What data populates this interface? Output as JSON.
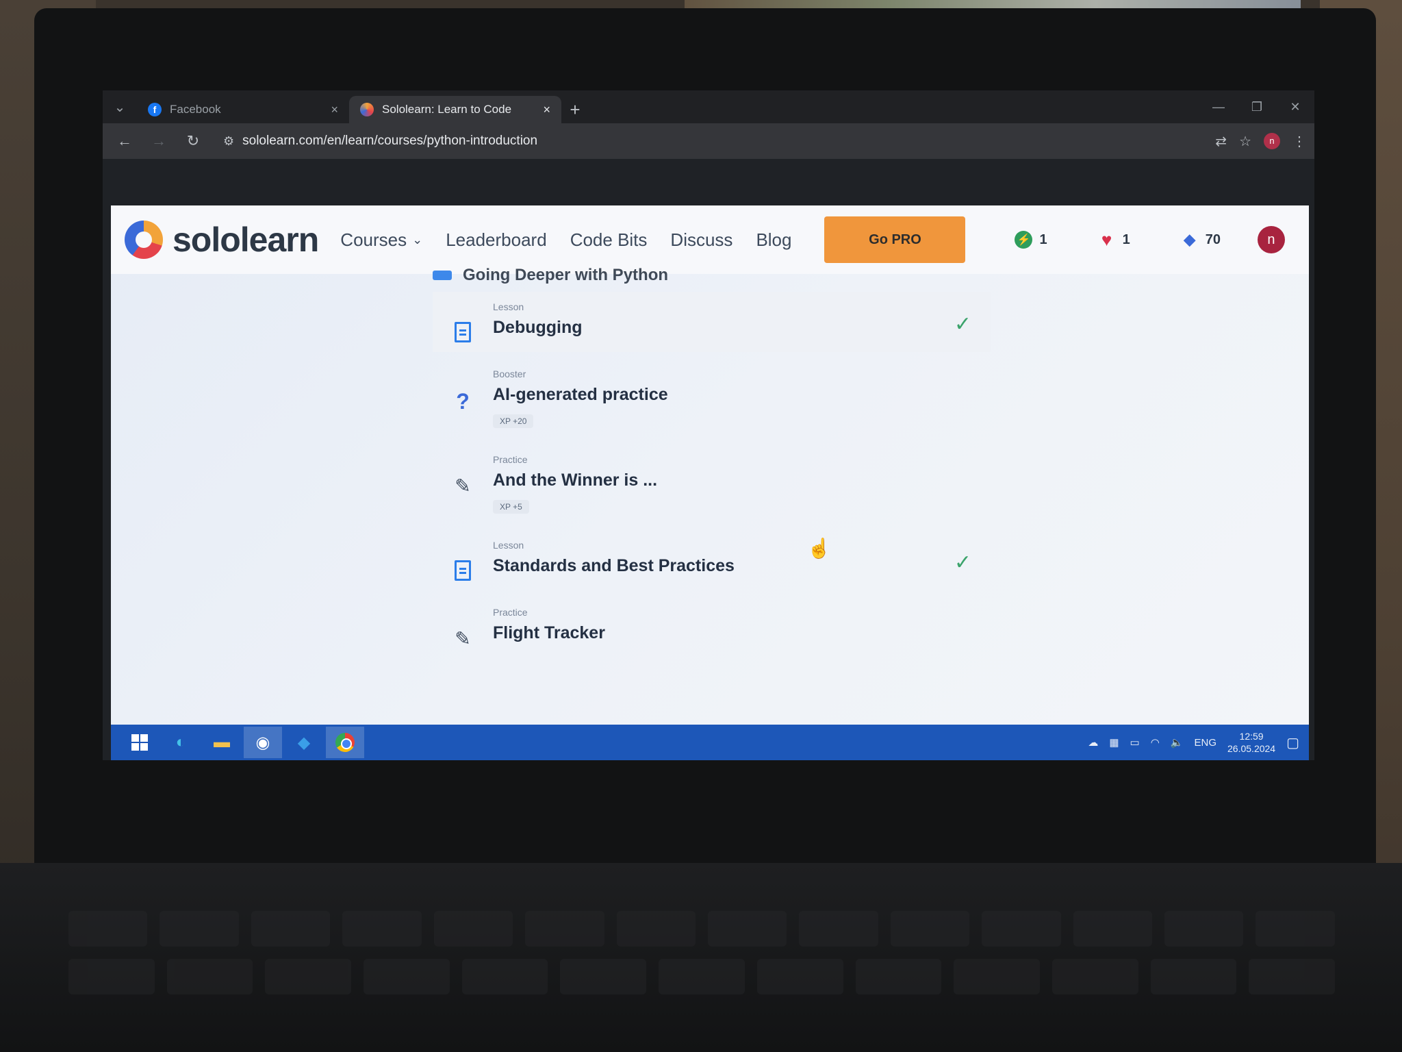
{
  "browser": {
    "tabs": [
      {
        "title": "Facebook",
        "active": false
      },
      {
        "title": "Sololearn: Learn to Code",
        "active": true
      }
    ],
    "url": "sololearn.com/en/learn/courses/python-introduction"
  },
  "navbar": {
    "logo": "sololearn",
    "menu": [
      "Courses",
      "Leaderboard",
      "Code Bits",
      "Discuss",
      "Blog"
    ],
    "go_pro": "Go PRO",
    "streak": "1",
    "hearts": "1",
    "gems": "70",
    "avatar_initial": "n"
  },
  "section_heading": "Going Deeper with Python",
  "lessons": [
    {
      "kind": "Lesson",
      "title": "Debugging",
      "xp": "",
      "completed": true,
      "icon": "document-icon"
    },
    {
      "kind": "Booster",
      "title": "AI-generated practice",
      "xp": "XP +20",
      "completed": false,
      "icon": "question-icon"
    },
    {
      "kind": "Practice",
      "title": "And the Winner is ...",
      "xp": "XP +5",
      "completed": false,
      "icon": "pencil-icon"
    },
    {
      "kind": "Lesson",
      "title": "Standards and Best Practices",
      "xp": "",
      "completed": true,
      "icon": "document-icon"
    },
    {
      "kind": "Practice",
      "title": "Flight Tracker",
      "xp": "",
      "completed": false,
      "icon": "pencil-icon"
    }
  ],
  "taskbar": {
    "lang": "ENG",
    "time": "12:59",
    "date": "26.05.2024"
  },
  "colors": {
    "accent": "#f0963c",
    "primary_blue": "#2b7de9",
    "check_green": "#3ba36b",
    "taskbar": "#1d57b8"
  }
}
